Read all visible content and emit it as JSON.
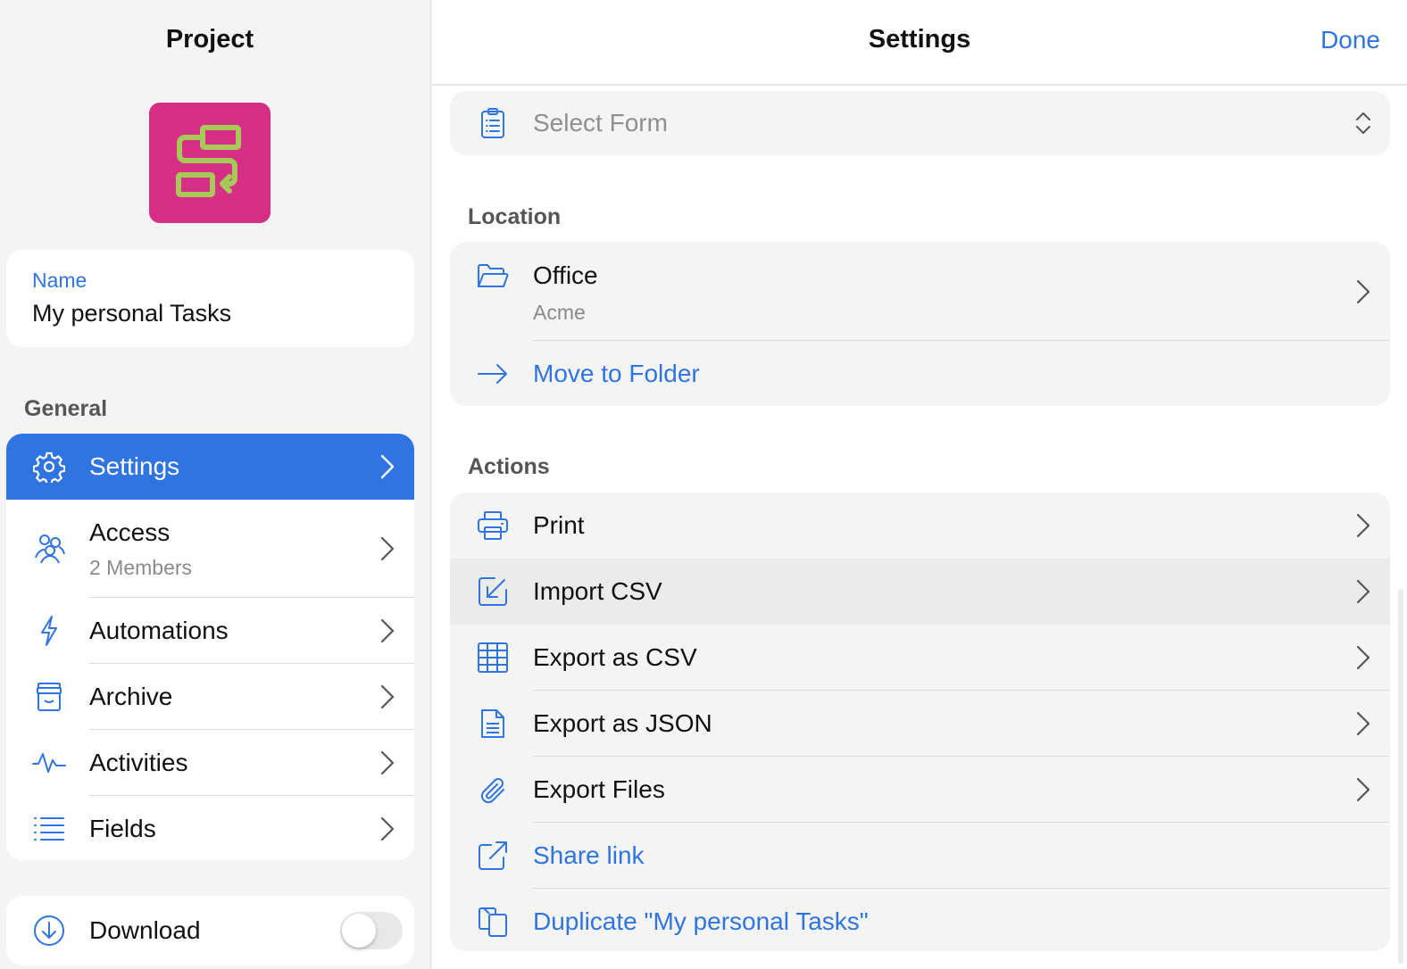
{
  "left": {
    "title": "Project",
    "name_card": {
      "label": "Name",
      "value": "My personal Tasks"
    },
    "general_header": "General",
    "nav_items": [
      {
        "label": "Settings",
        "icon": "gear-icon",
        "active": true
      },
      {
        "label": "Access",
        "sub": "2 Members",
        "icon": "people-icon"
      },
      {
        "label": "Automations",
        "icon": "bolt-icon"
      },
      {
        "label": "Archive",
        "icon": "archive-box-icon"
      },
      {
        "label": "Activities",
        "icon": "pulse-icon"
      },
      {
        "label": "Fields",
        "icon": "list-icon"
      }
    ],
    "download": {
      "label": "Download",
      "toggle_on": false
    }
  },
  "right": {
    "title": "Settings",
    "done_label": "Done",
    "form_select": {
      "placeholder": "Select Form"
    },
    "location_header": "Location",
    "location": {
      "folder": "Office",
      "workspace": "Acme",
      "move_label": "Move to Folder"
    },
    "actions_header": "Actions",
    "actions": [
      {
        "label": "Print",
        "icon": "printer-icon",
        "chevron": true
      },
      {
        "label": "Import CSV",
        "icon": "import-icon",
        "chevron": true
      },
      {
        "label": "Export as CSV",
        "icon": "table-icon",
        "chevron": true
      },
      {
        "label": "Export as JSON",
        "icon": "document-icon",
        "chevron": true
      },
      {
        "label": "Export Files",
        "icon": "paperclip-icon",
        "chevron": true
      },
      {
        "label": "Share link",
        "icon": "share-external-icon",
        "link": true
      },
      {
        "label": "Duplicate \"My personal Tasks\"",
        "icon": "duplicate-icon",
        "link": true
      }
    ]
  },
  "colors": {
    "accent": "#2f74e0",
    "app_icon_bg": "#d72e86",
    "app_icon_fg": "#a7c957"
  }
}
